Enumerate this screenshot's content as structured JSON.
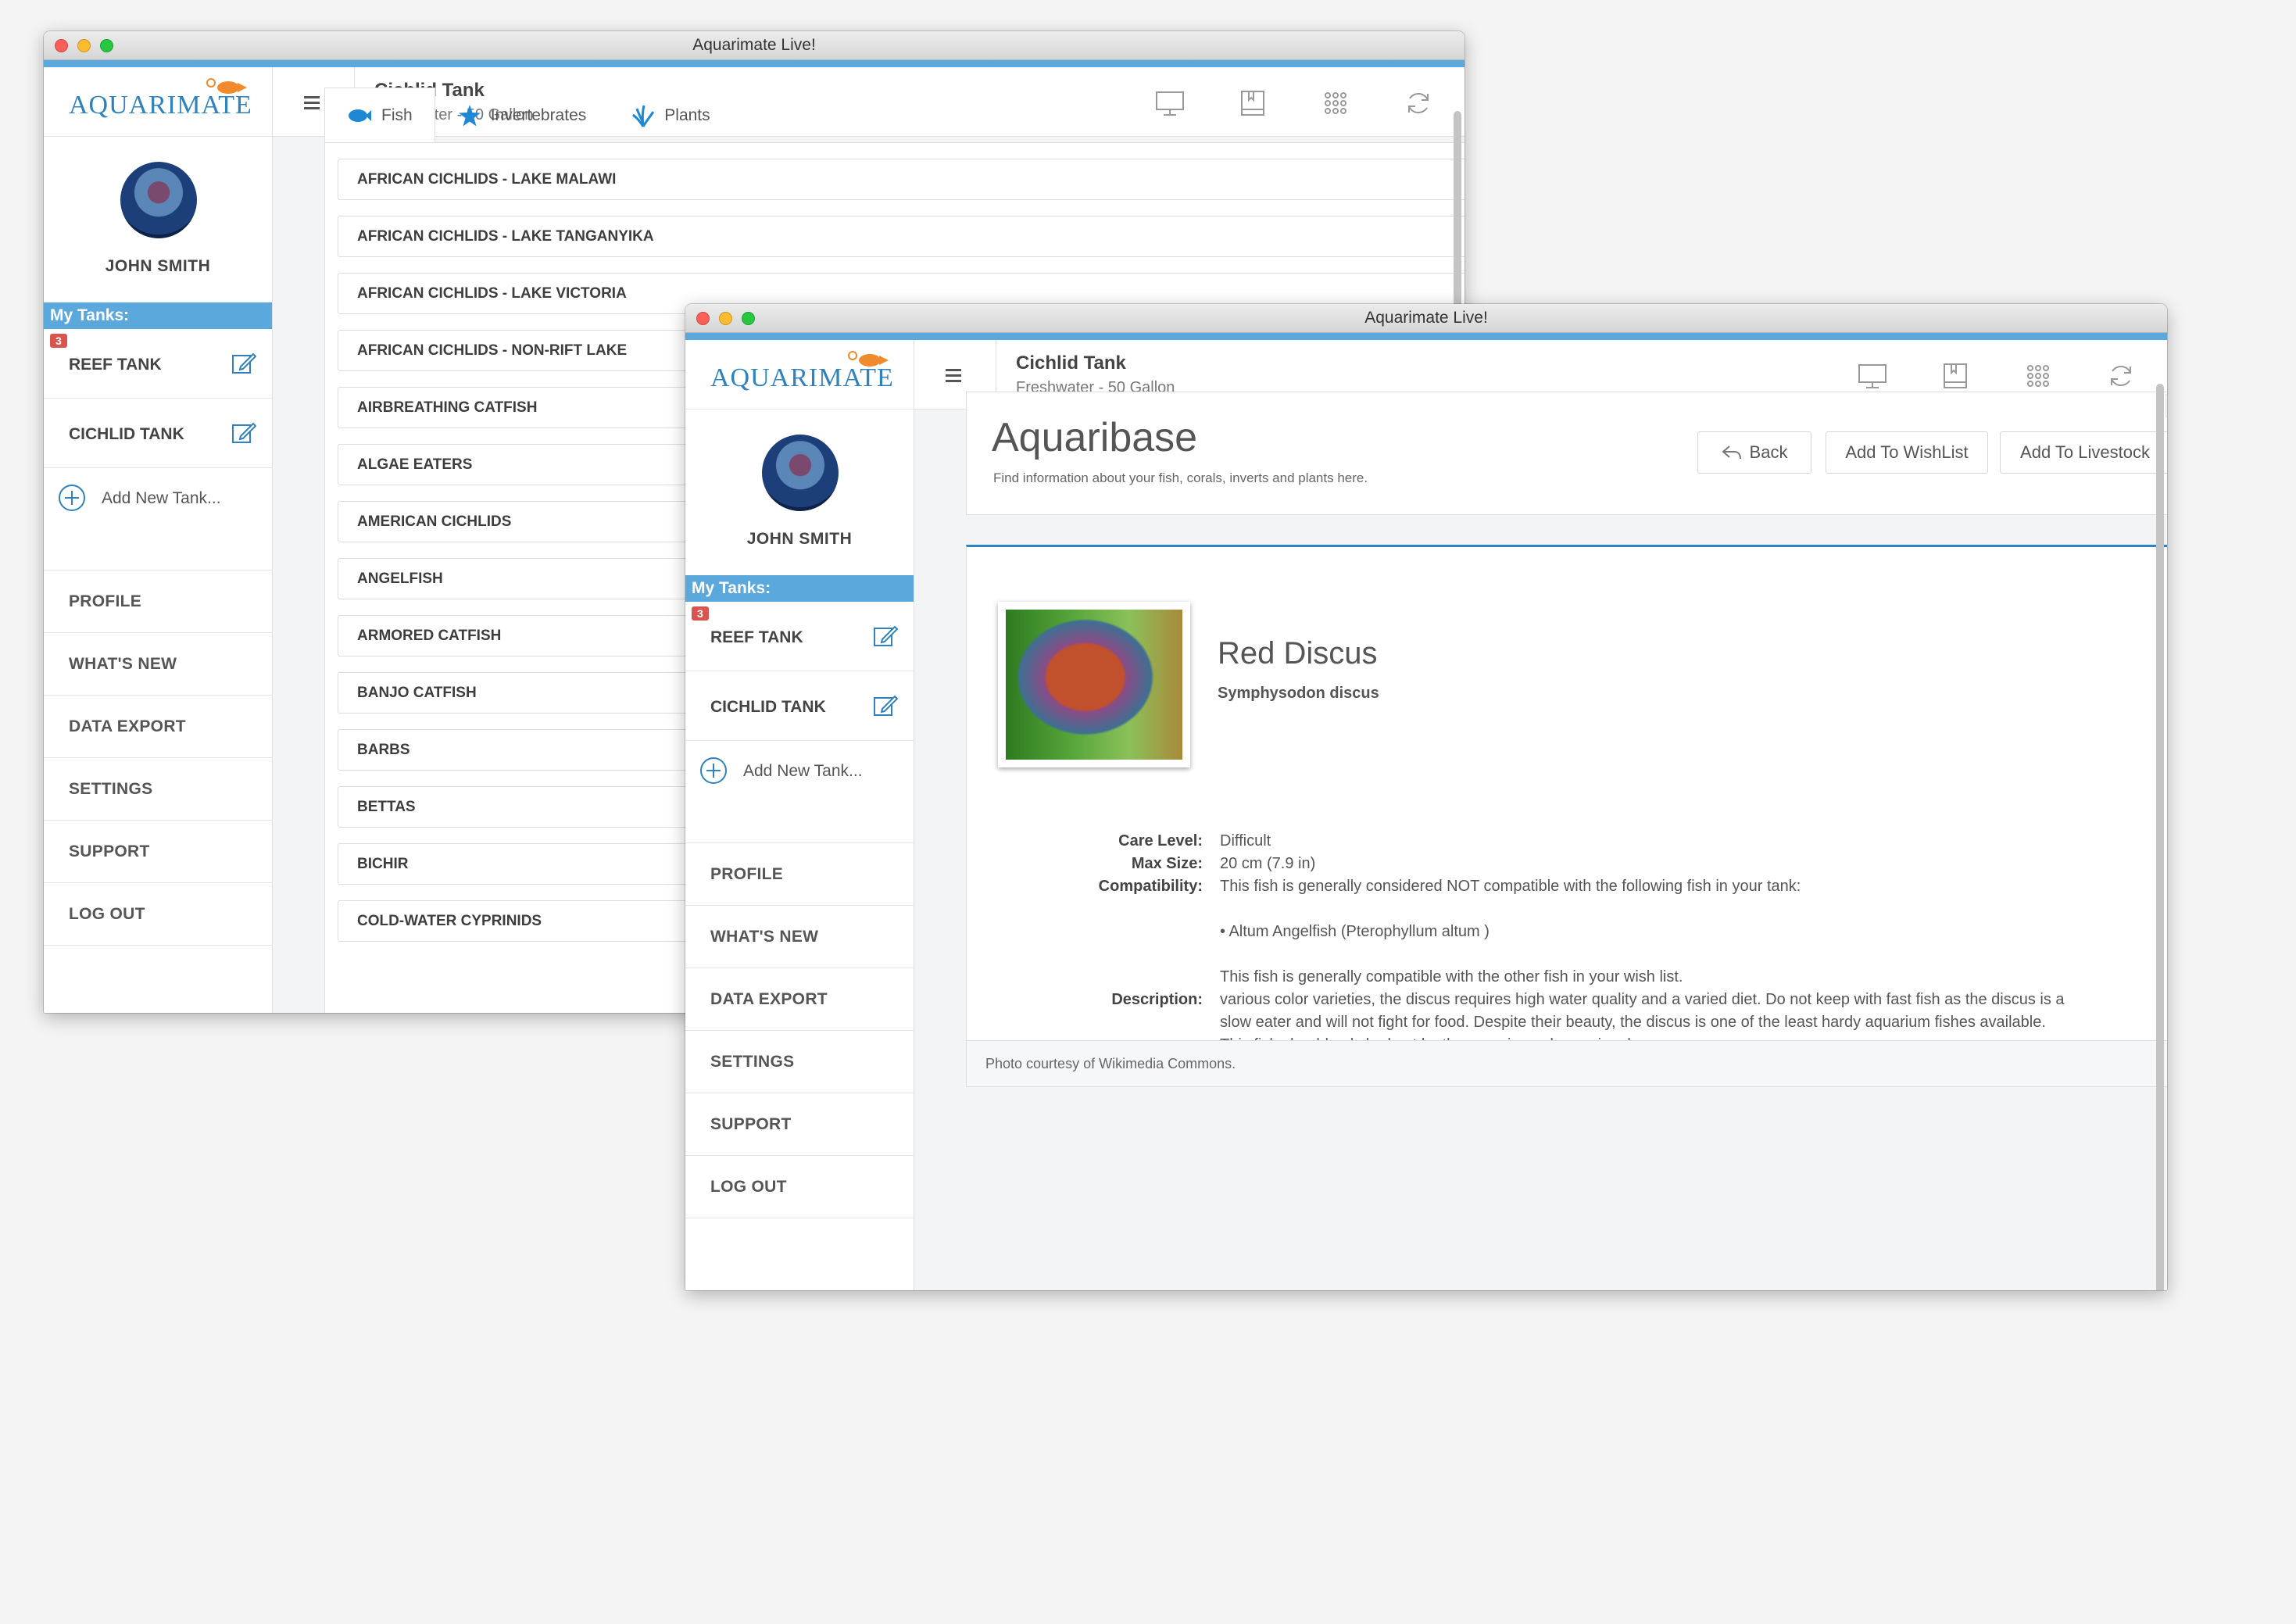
{
  "window_title": "Aquarimate Live!",
  "brand": {
    "logo_text": "AQUARIMATE"
  },
  "colors": {
    "accent": "#5aa8dc",
    "brand_blue": "#2f82bd",
    "badge_red": "#d9534f",
    "logo_orange": "#f08a2c"
  },
  "sidebar": {
    "user_name": "JOHN SMITH",
    "my_tanks_label": "My Tanks:",
    "tanks": [
      {
        "name": "REEF TANK",
        "badge": "3"
      },
      {
        "name": "CICHLID TANK",
        "badge": ""
      }
    ],
    "add_tank_label": "Add New Tank...",
    "nav": [
      "PROFILE",
      "WHAT'S NEW",
      "DATA EXPORT",
      "SETTINGS",
      "SUPPORT",
      "LOG OUT"
    ]
  },
  "topbar": {
    "tank_title": "Cichlid Tank",
    "tank_subtitle": "Freshwater - 50 Gallon",
    "icons": [
      "monitor-icon",
      "book-icon",
      "grid-icon",
      "refresh-icon"
    ]
  },
  "browse": {
    "tabs": [
      {
        "label": "Fish",
        "icon": "fish-icon"
      },
      {
        "label": "Invertebrates",
        "icon": "starfish-icon"
      },
      {
        "label": "Plants",
        "icon": "plant-icon"
      }
    ],
    "categories": [
      "AFRICAN CICHLIDS - LAKE MALAWI",
      "AFRICAN CICHLIDS - LAKE TANGANYIKA",
      "AFRICAN CICHLIDS - LAKE VICTORIA",
      "AFRICAN CICHLIDS - NON-RIFT LAKE",
      "AIRBREATHING CATFISH",
      "ALGAE EATERS",
      "AMERICAN CICHLIDS",
      "ANGELFISH",
      "ARMORED CATFISH",
      "BANJO CATFISH",
      "BARBS",
      "BETTAS",
      "BICHIR",
      "COLD-WATER CYPRINIDS"
    ]
  },
  "aquaribase": {
    "title": "Aquaribase",
    "subtitle": "Find information about your fish, corals, inverts and plants here.",
    "buttons": {
      "back": "Back",
      "wishlist": "Add To WishList",
      "livestock": "Add To Livestock"
    },
    "species": {
      "common_name": "Red Discus",
      "scientific_name": "Symphysodon discus",
      "care_level_label": "Care Level:",
      "care_level": "Difficult",
      "max_size_label": "Max Size:",
      "max_size": "20 cm (7.9 in)",
      "compat_label": "Compatibility:",
      "compat_text": "This fish is generally considered NOT compatible with the following fish in your tank:",
      "compat_item": "• Altum Angelfish (Pterophyllum altum )",
      "wishlist_text": "This fish is generally compatible with the other fish in your wish list.",
      "description_label": "Description:",
      "description_lines": [
        "various color varieties, the discus requires high water quality and a varied diet. Do not keep with fast fish as the discus is a",
        "slow eater and will not fight for food. Despite their beauty, the discus is one of the least hardy aquarium fishes available.",
        "This fish should only be kept by the experienced aquarium keeper."
      ]
    },
    "photo_credit": "Photo courtesy of Wikimedia Commons."
  }
}
